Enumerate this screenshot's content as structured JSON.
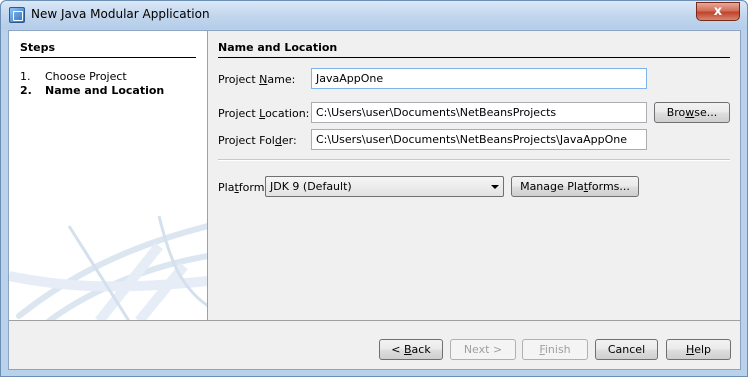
{
  "window": {
    "title": "New Java Modular Application",
    "close_glyph": "x"
  },
  "steps": {
    "title": "Steps",
    "items": [
      {
        "num": "1.",
        "label": "Choose Project"
      },
      {
        "num": "2.",
        "label": "Name and Location"
      }
    ]
  },
  "main": {
    "title": "Name and Location",
    "project_name": {
      "label_pre": "Project ",
      "label_key": "N",
      "label_post": "ame:",
      "value": "JavaAppOne"
    },
    "project_location": {
      "label_pre": "Project ",
      "label_key": "L",
      "label_post": "ocation:",
      "value": "C:\\Users\\user\\Documents\\NetBeansProjects"
    },
    "project_folder": {
      "label_pre": "Project Fol",
      "label_key": "d",
      "label_post": "er:",
      "value": "C:\\Users\\user\\Documents\\NetBeansProjects\\JavaAppOne"
    },
    "browse_button": {
      "pre": "Bro",
      "key": "w",
      "post": "se..."
    },
    "platform": {
      "label_pre": "Pla",
      "label_key": "t",
      "label_post": "form:",
      "selected": "JDK 9 (Default)"
    },
    "manage_platforms_button": {
      "pre": "Manage Pla",
      "key": "t",
      "post": "forms..."
    }
  },
  "footer": {
    "back": {
      "pre": "< ",
      "key": "B",
      "post": "ack"
    },
    "next": {
      "pre": "Next >",
      "key": "",
      "post": ""
    },
    "finish": {
      "pre": "",
      "key": "F",
      "post": "inish"
    },
    "cancel": {
      "pre": "Cancel",
      "key": "",
      "post": ""
    },
    "help": {
      "pre": "",
      "key": "H",
      "post": "elp"
    }
  }
}
